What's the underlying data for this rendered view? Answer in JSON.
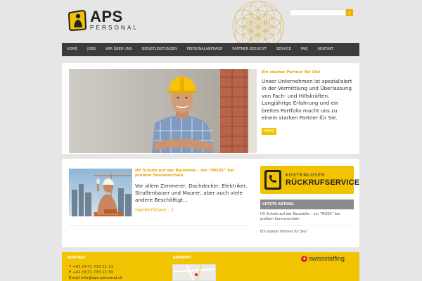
{
  "brand": {
    "name": "APS",
    "subtitle": "PERSONAL"
  },
  "search": {
    "placeholder": "",
    "button_icon": "search-icon"
  },
  "nav": {
    "items": [
      {
        "label": "Home"
      },
      {
        "label": "Jobs"
      },
      {
        "label": "Wir über uns"
      },
      {
        "label": "Dienstleistungen"
      },
      {
        "label": "Personalanfrage"
      },
      {
        "label": "Partner gesucht"
      },
      {
        "label": "Service"
      },
      {
        "label": "FAQ"
      },
      {
        "label": "Kontakt"
      }
    ]
  },
  "hero": {
    "title": "Ein starker Partner für Sie!",
    "text": "Unser Unternehmen ist spezialisiert in der Vermittlung und Überlassung von Fach- und Hilfskräften. Langjährige Erfahrung und ein breites Portfolio macht uns zu einem starken Partner für Sie.",
    "more_label": "MEHR"
  },
  "article": {
    "title": "UV Schutz auf der Baustelle – ein “MUSS” bei prallem Sonnenschein",
    "text": "Vor allem Zimmerer, Dachdecker, Elektriker, Straßenbauer und Maurer, aber auch viele andere Beschäftigt…",
    "readmore": "(weiterlesen…)"
  },
  "callback": {
    "top": "KOSTENLOSER",
    "main": "RÜCKRUFSERVICE"
  },
  "latest": {
    "heading": "LETZTE ARTIKEL",
    "items": [
      {
        "label": "UV Schutz auf der Baustelle – ein “MUSS” bei prallem Sonnenschein"
      },
      {
        "label": "Ein starker Partner für Sie!"
      }
    ]
  },
  "footer": {
    "contact_heading": "KONTAKT",
    "phone": "T +41 (0)71 733 11 11",
    "fax": "F +41 (0)71 733 11 33",
    "email": "Email info@aps-personal.ch",
    "directions_heading": "ANFAHRT",
    "partner_logo": "swissstaffing"
  },
  "colors": {
    "accent": "#f2c300",
    "nav_bg": "#3b3b3b",
    "page_bg": "#e6e6e6",
    "link": "#e6a300"
  }
}
